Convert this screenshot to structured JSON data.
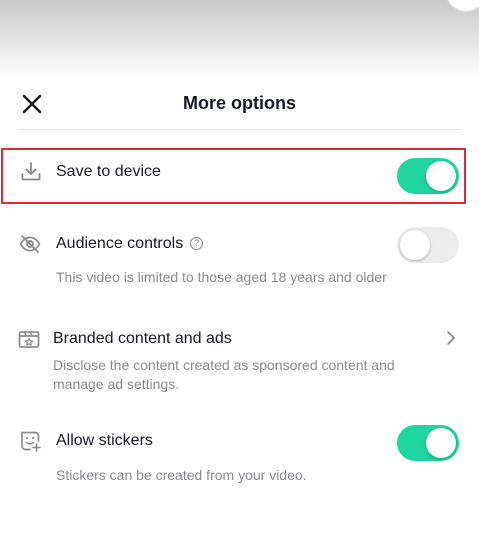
{
  "header": {
    "title": "More options"
  },
  "rows": [
    {
      "label": "Save to device",
      "toggle": "on"
    },
    {
      "label": "Audience controls",
      "description": "This video is limited to those aged 18 years and older",
      "toggle": "off"
    },
    {
      "label": "Branded content and ads",
      "description_line1": "Disclose the content created as sponsored content and",
      "description_line2": "manage ad settings."
    },
    {
      "label": "Allow stickers",
      "description": "Stickers can be created from your video.",
      "toggle": "on"
    }
  ],
  "colors": {
    "toggle_on": "#20d5a0",
    "toggle_off": "#ececed",
    "highlight": "#d92b36",
    "text_primary": "#161823",
    "text_secondary": "#8a8b91"
  },
  "icons": {
    "close": "close-icon",
    "save": "download-icon",
    "audience": "eye-off-icon",
    "help": "question-icon",
    "branded": "ad-badge-icon",
    "chevron": "chevron-right-icon",
    "stickers": "sticker-icon"
  }
}
